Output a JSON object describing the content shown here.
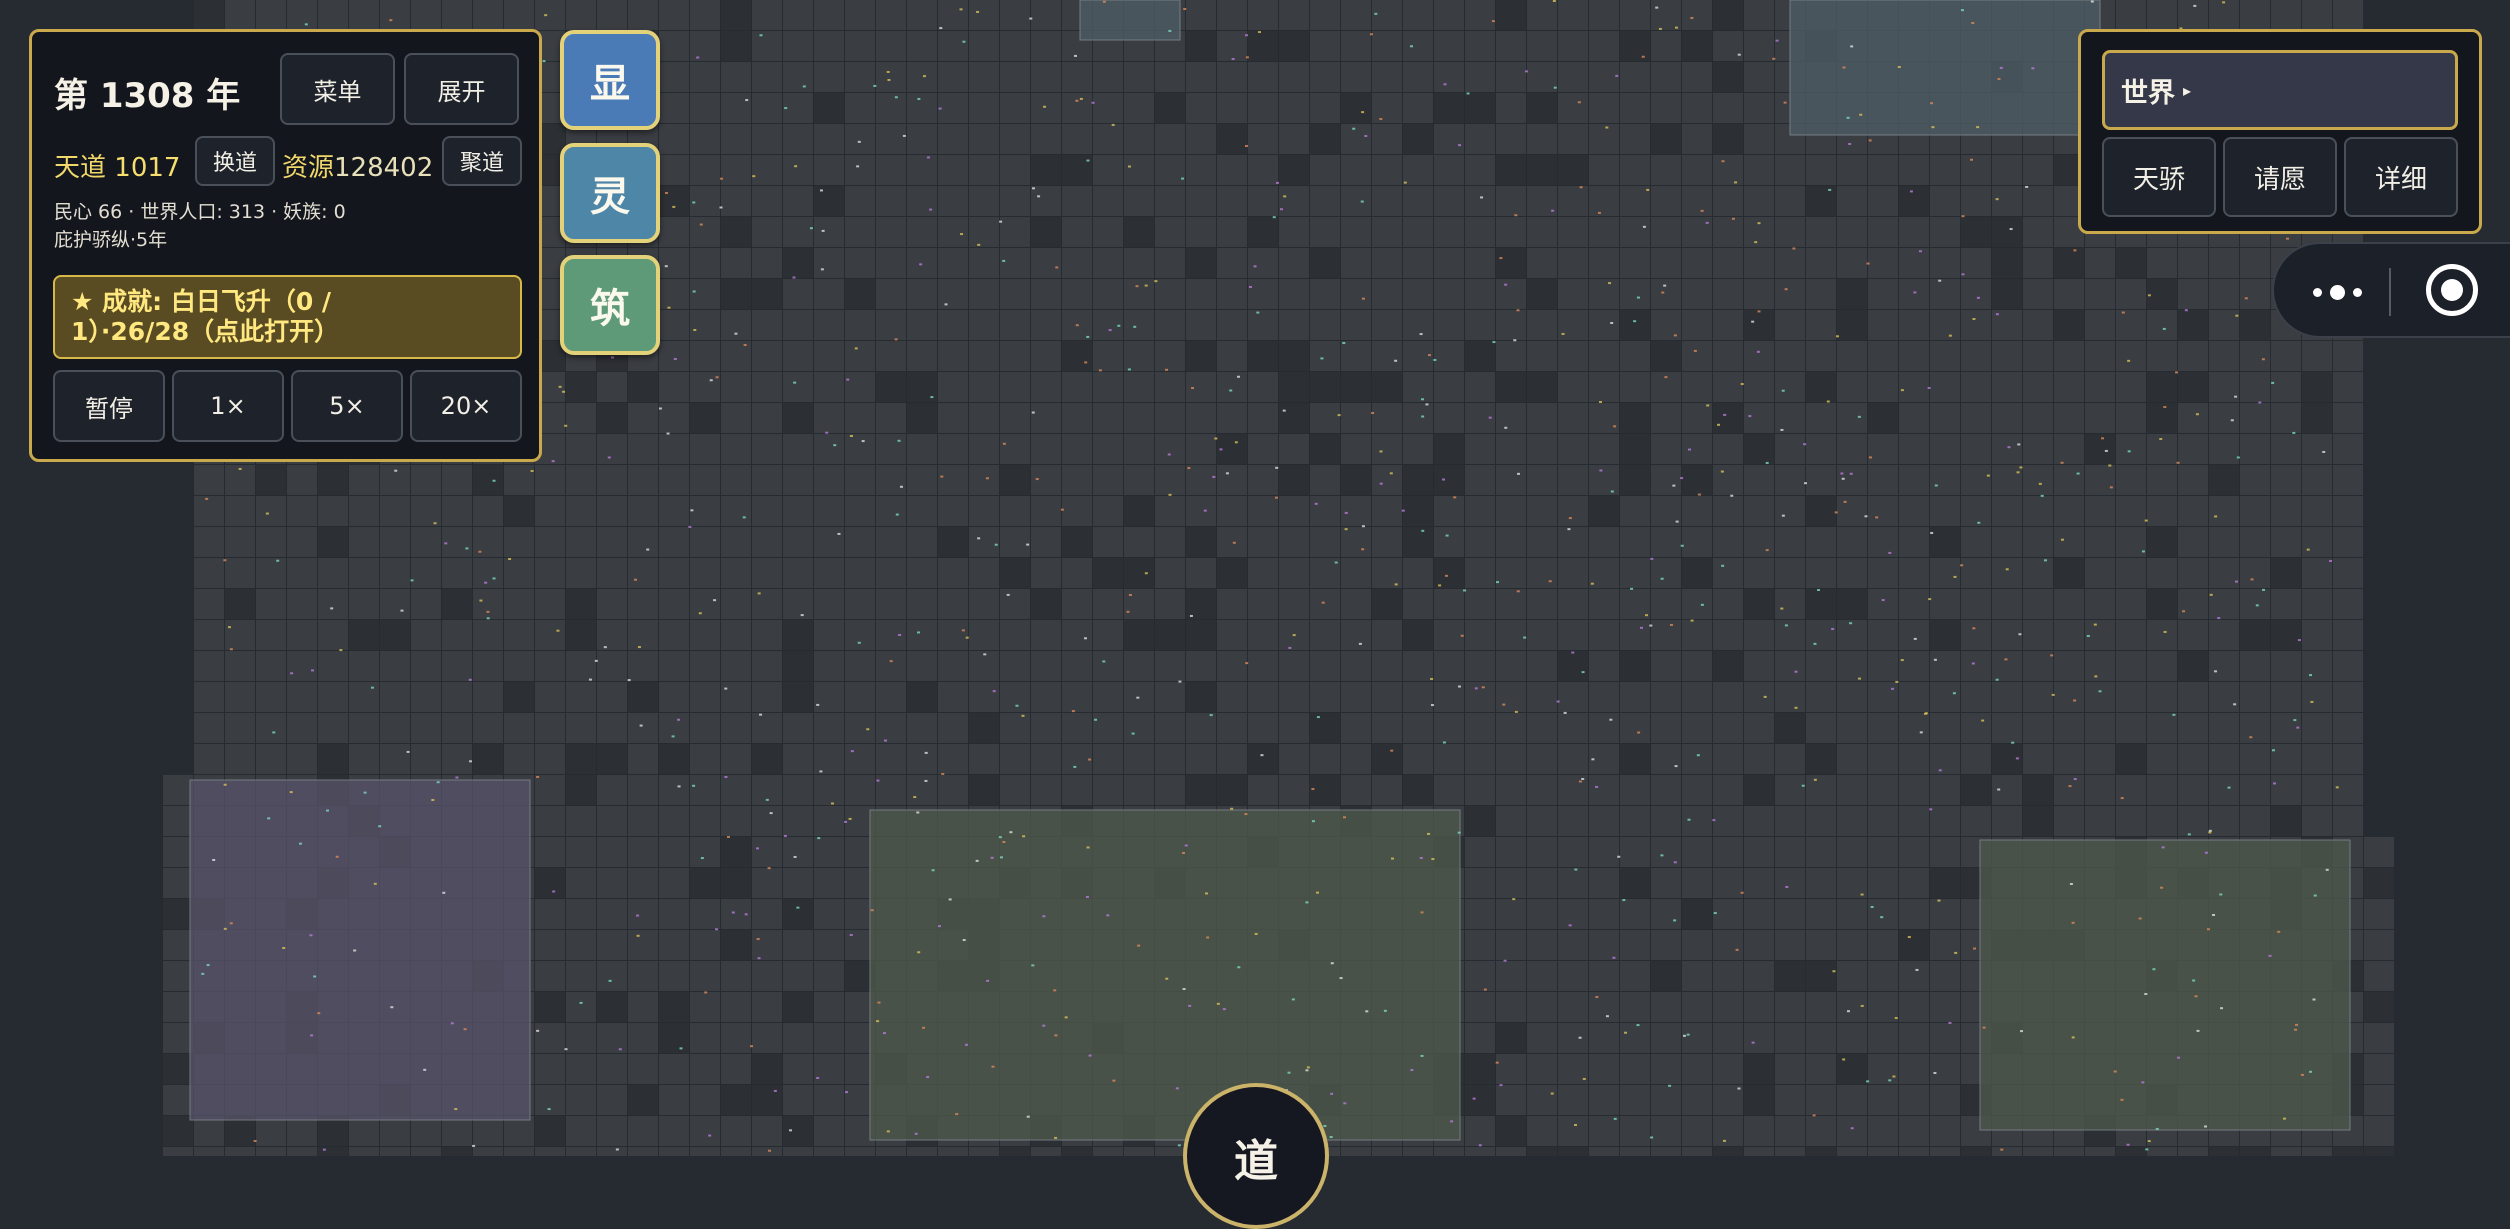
{
  "hud": {
    "year": "第 1308 年",
    "menu_label": "菜单",
    "expand_label": "展开",
    "tiandao_label": "天道",
    "tiandao_value": "1017",
    "switch_dao_label": "换道",
    "resource_label": "资源",
    "resource_value": "128402",
    "gather_dao_label": "聚道",
    "stats_line": "民心 66 · 世界人口: 313 · 妖族: 0",
    "blessing_line": "庇护骄纵·5年",
    "achievement_line1": "★ 成就: 白日飞升（0 /",
    "achievement_line2": "1）·26/28（点此打开）",
    "speed": {
      "pause": "暂停",
      "x1": "1×",
      "x5": "5×",
      "x20": "20×"
    }
  },
  "categories": [
    {
      "label": "显",
      "color": "#4a7bb6"
    },
    {
      "label": "灵",
      "color": "#4e86a8"
    },
    {
      "label": "筑",
      "color": "#5e9a78"
    }
  ],
  "world_panel": {
    "select_value": "世界",
    "select_arrow": "▸",
    "tianjiao_label": "天骄",
    "wish_label": "请愿",
    "detail_label": "详细"
  },
  "capsule": {
    "more_icon": "more-dots-icon",
    "record_icon": "target-icon"
  },
  "dao_button": "道",
  "map_colors": {
    "tile": "#3a3d42",
    "tile_dark": "#2c2f34",
    "grid": "#1a1c20",
    "zone_purple": "#575369",
    "zone_green": "#4e5a4c",
    "zone_blue": "#4f5e66"
  }
}
